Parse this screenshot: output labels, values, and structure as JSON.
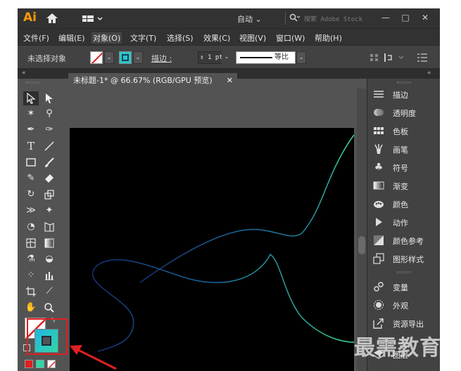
{
  "titlebar": {
    "logo": "Ai",
    "workspace": "自动 ⌄",
    "search_placeholder": "搜索 Adobe Stock",
    "window_buttons": [
      "—",
      "□",
      "✕"
    ]
  },
  "menu": [
    "文件(F)",
    "编辑(E)",
    "对象(O)",
    "文字(T)",
    "选择(S)",
    "效果(C)",
    "视图(V)",
    "窗口(W)",
    "帮助(H)"
  ],
  "control": {
    "selection_status": "未选择对象",
    "stroke_label": "描边 :",
    "stroke_value": "1 pt",
    "profile_label": "等比"
  },
  "document": {
    "tab_title": "未标题-1* @ 66.67% (RGB/GPU 预览)",
    "close": "✕"
  },
  "panels": [
    {
      "label": "描边",
      "icon": "stroke-icon"
    },
    {
      "label": "透明度",
      "icon": "transparency-icon"
    },
    {
      "label": "色板",
      "icon": "swatches-icon"
    },
    {
      "label": "画笔",
      "icon": "brushes-icon"
    },
    {
      "label": "符号",
      "icon": "symbols-icon"
    },
    {
      "label": "渐变",
      "icon": "gradient-icon"
    },
    {
      "label": "颜色",
      "icon": "color-icon"
    },
    {
      "label": "动作",
      "icon": "actions-icon"
    },
    {
      "label": "颜色参考",
      "icon": "color-guide-icon"
    },
    {
      "label": "图形样式",
      "icon": "graphic-styles-icon"
    },
    {
      "label": "变量",
      "icon": "variables-icon"
    },
    {
      "label": "外观",
      "icon": "appearance-icon"
    },
    {
      "label": "资源导出",
      "icon": "asset-export-icon"
    },
    {
      "label": "图层",
      "icon": "layers-icon"
    }
  ],
  "watermark": "最需教育",
  "colors": {
    "accent_orange": "#ff9a00",
    "curve_dark_blue": "#16357a",
    "curve_teal": "#2a9fb0",
    "curve_green": "#3ed2a0",
    "highlight_red": "#e02020"
  }
}
